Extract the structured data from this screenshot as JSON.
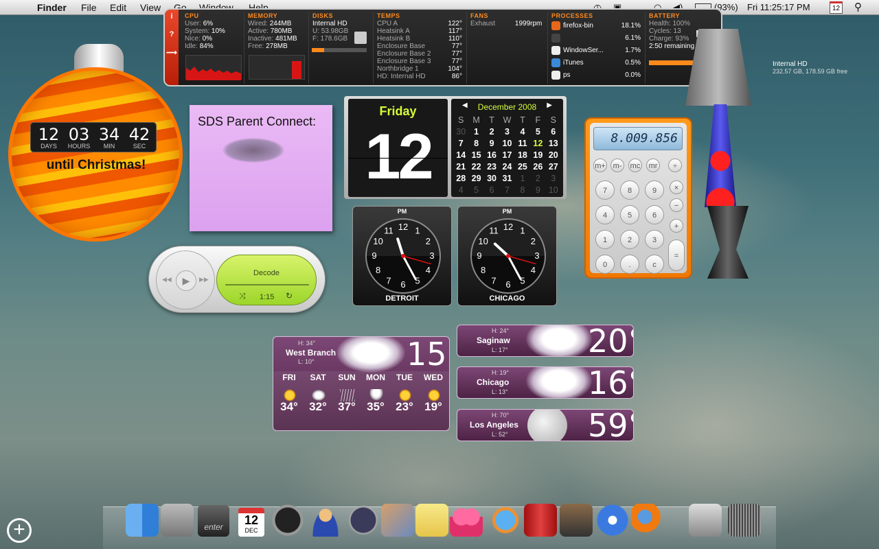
{
  "menubar": {
    "app": "Finder",
    "items": [
      "File",
      "Edit",
      "View",
      "Go",
      "Window",
      "Help"
    ],
    "battery": "(93%)",
    "clock": "Fri 11:25:17 PM",
    "cal_day": "12"
  },
  "istat": {
    "cpu": {
      "title": "CPU",
      "rows": [
        [
          "User:",
          "6%"
        ],
        [
          "System:",
          "10%"
        ],
        [
          "Nice:",
          "0%"
        ],
        [
          "Idle:",
          "84%"
        ]
      ]
    },
    "memory": {
      "title": "MEMORY",
      "rows": [
        [
          "Wired:",
          "244MB"
        ],
        [
          "Active:",
          "780MB"
        ],
        [
          "Inactive:",
          "481MB"
        ],
        [
          "Free:",
          "278MB"
        ]
      ]
    },
    "disks": {
      "title": "DISKS",
      "name": "Internal HD",
      "used": "U: 53.98GB",
      "free": "F: 178.6GB"
    },
    "temps": {
      "title": "TEMPS",
      "rows": [
        [
          "CPU A",
          "122°"
        ],
        [
          "Heatsink A",
          "117°"
        ],
        [
          "Heatsink B",
          "110°"
        ],
        [
          "Enclosure Base",
          "77°"
        ],
        [
          "Enclosure Base 2",
          "77°"
        ],
        [
          "Enclosure Base 3",
          "77°"
        ],
        [
          "Northbridge 1",
          "104°"
        ],
        [
          "HD: Internal HD",
          "86°"
        ]
      ]
    },
    "fans": {
      "title": "FANS",
      "rows": [
        [
          "Exhaust",
          "1999rpm"
        ]
      ]
    },
    "processes": {
      "title": "PROCESSES",
      "rows": [
        [
          "firefox-bin",
          "18.1%"
        ],
        [
          "",
          "6.1%"
        ],
        [
          "WindowSer...",
          "1.7%"
        ],
        [
          "iTunes",
          "0.5%"
        ],
        [
          "ps",
          "0.0%"
        ]
      ]
    },
    "battery": {
      "title": "BATTERY",
      "health": "Health: 100%",
      "cycles": "Cycles: 13",
      "charge": "Charge: 93%",
      "remaining": "2:50 remaining",
      "level": 0.93
    }
  },
  "countdown": {
    "days": "12",
    "hours": "03",
    "min": "34",
    "sec": "42",
    "l_days": "DAYS",
    "l_hours": "HOURS",
    "l_min": "MIN",
    "l_sec": "SEC",
    "caption": "until Christmas!"
  },
  "sticky": {
    "title": "SDS Parent Connect:"
  },
  "itunes": {
    "track": "Decode",
    "time": "1:15"
  },
  "calendar": {
    "weekday": "Friday",
    "day": "12",
    "month": "December 2008",
    "headers": [
      "S",
      "M",
      "T",
      "W",
      "T",
      "F",
      "S"
    ],
    "days": [
      "30",
      "1",
      "2",
      "3",
      "4",
      "5",
      "6",
      "7",
      "8",
      "9",
      "10",
      "11",
      "12",
      "13",
      "14",
      "15",
      "16",
      "17",
      "18",
      "19",
      "20",
      "21",
      "22",
      "23",
      "24",
      "25",
      "26",
      "27",
      "28",
      "29",
      "30",
      "31",
      "1",
      "2",
      "3",
      "4",
      "5",
      "6",
      "7",
      "8",
      "9",
      "10"
    ]
  },
  "clocks": [
    {
      "ampm": "PM",
      "city": "DETROIT"
    },
    {
      "ampm": "PM",
      "city": "CHICAGO"
    }
  ],
  "calculator": {
    "display": "8.009.856",
    "keys": [
      "m+",
      "m-",
      "mc",
      "mr",
      "÷",
      "7",
      "8",
      "9",
      "×",
      "4",
      "5",
      "6",
      "−",
      "1",
      "2",
      "3",
      "+",
      "0",
      ".",
      "c",
      "="
    ]
  },
  "hd": {
    "name": "Internal HD",
    "space": "232.57 GB, 178.59 GB free"
  },
  "weather": {
    "west": {
      "hi": "H: 34°",
      "city": "West Branch",
      "lo": "L: 10°",
      "temp": "15°",
      "days": [
        [
          "FRI",
          "34°"
        ],
        [
          "SAT",
          "32°"
        ],
        [
          "SUN",
          "37°"
        ],
        [
          "MON",
          "35°"
        ],
        [
          "TUE",
          "23°"
        ],
        [
          "WED",
          "19°"
        ]
      ]
    },
    "saginaw": {
      "hi": "H: 24°",
      "city": "Saginaw",
      "lo": "L: 17°",
      "temp": "20°"
    },
    "chicago": {
      "hi": "H: 19°",
      "city": "Chicago",
      "lo": "L: 13°",
      "temp": "16°"
    },
    "la": {
      "hi": "H: 70°",
      "city": "Los Angeles",
      "lo": "L: 52°",
      "temp": "59°"
    }
  },
  "dock": {
    "cal_day": "12",
    "cal_month": "DEC",
    "key_label": "enter"
  },
  "colors": {
    "accent": "#ff8a1c",
    "lime": "#d6ff3a",
    "weather_bg": "#5e2d57"
  }
}
